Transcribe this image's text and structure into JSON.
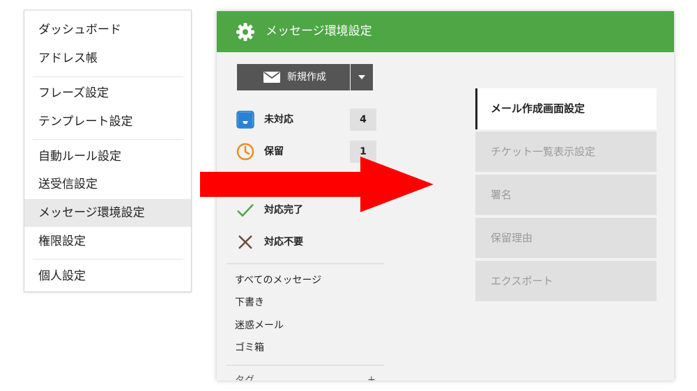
{
  "dropdown_menu": {
    "items": [
      {
        "label": "ダッシュボード"
      },
      {
        "label": "アドレス帳"
      },
      {
        "label": "フレーズ設定"
      },
      {
        "label": "テンプレート設定"
      },
      {
        "label": "自動ルール設定"
      },
      {
        "label": "送受信設定"
      },
      {
        "label": "メッセージ環境設定",
        "active": true
      },
      {
        "label": "権限設定"
      },
      {
        "label": "個人設定"
      }
    ]
  },
  "header": {
    "title": "メッセージ環境設定",
    "icon": "gear-icon",
    "color": "#4ea645"
  },
  "compose": {
    "label": "新規作成",
    "icon": "mail-icon",
    "dropdown_icon": "caret-down-icon"
  },
  "folders": [
    {
      "label": "未対応",
      "count": "4",
      "icon": "inbox-icon",
      "icon_color": "#2a82d4"
    },
    {
      "label": "保留",
      "count": "1",
      "icon": "clock-icon",
      "icon_color": "#f08c1e"
    },
    {
      "label": "対応完了",
      "icon": "check-icon",
      "icon_color": "#4ea645"
    },
    {
      "label": "対応不要",
      "icon": "x-icon",
      "icon_color": "#6b4a3a"
    }
  ],
  "message_links": [
    "すべてのメッセージ",
    "下書き",
    "迷惑メール",
    "ゴミ箱"
  ],
  "partial_section_label": "タグ",
  "settings_tabs": [
    {
      "label": "メール作成画面設定",
      "active": true
    },
    {
      "label": "チケット一覧表示設定"
    },
    {
      "label": "署名"
    },
    {
      "label": "保留理由"
    },
    {
      "label": "エクスポート"
    }
  ],
  "annotation": {
    "arrow_color": "#ff0000"
  }
}
